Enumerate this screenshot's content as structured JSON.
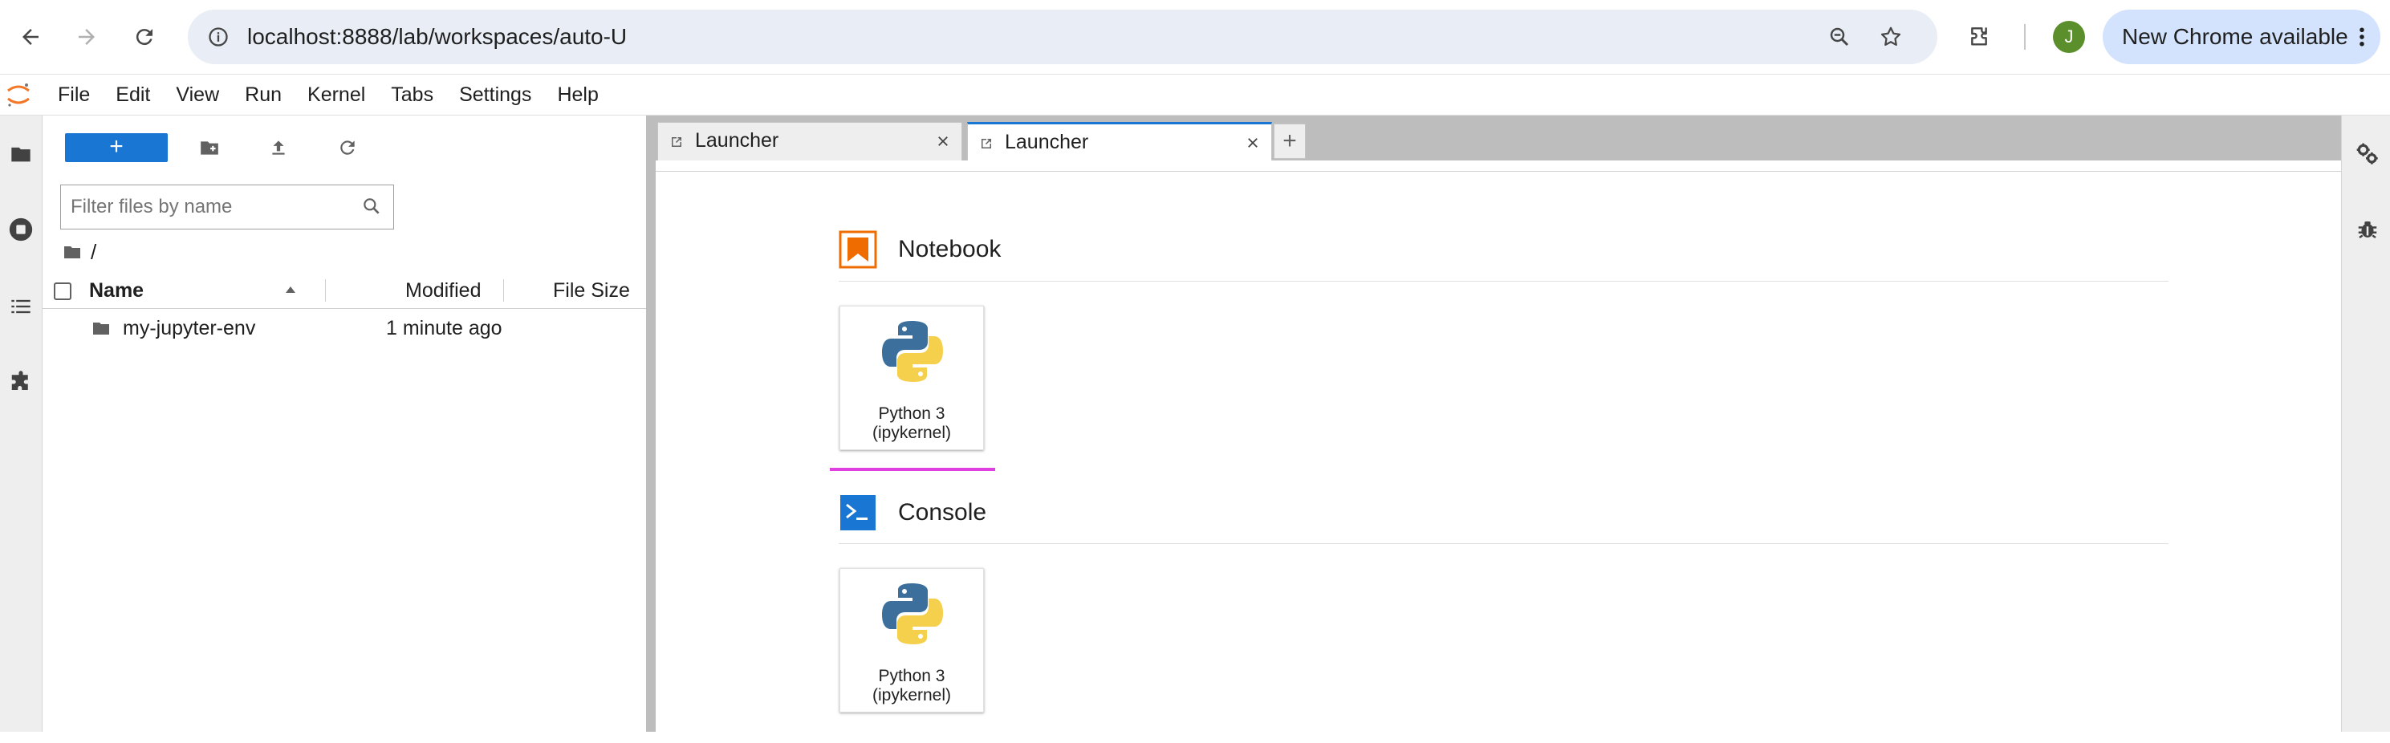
{
  "browser": {
    "url": "localhost:8888/lab/workspaces/auto-U",
    "avatar_letter": "J",
    "update_label": "New Chrome available",
    "icons": [
      "back-arrow-icon",
      "forward-arrow-icon",
      "reload-icon",
      "site-info-icon",
      "zoom-icon",
      "bookmark-star-icon",
      "extensions-icon",
      "more-vert-icon"
    ]
  },
  "menubar": {
    "items": [
      "File",
      "Edit",
      "View",
      "Run",
      "Kernel",
      "Tabs",
      "Settings",
      "Help"
    ]
  },
  "file_browser": {
    "new_button_label": "+",
    "filter_placeholder": "Filter files by name",
    "breadcrumb": "/",
    "columns": {
      "name": "Name",
      "modified": "Modified",
      "size": "File Size"
    },
    "rows": [
      {
        "name": "my-jupyter-env",
        "modified": "1 minute ago",
        "size": ""
      }
    ]
  },
  "tabs": [
    {
      "label": "Launcher",
      "active": false
    },
    {
      "label": "Launcher",
      "active": true
    }
  ],
  "add_tab_label": "+",
  "launcher": {
    "sections": [
      {
        "title": "Notebook",
        "cards": [
          {
            "label": "Python 3\n(ipykernel)"
          }
        ]
      },
      {
        "title": "Console",
        "cards": [
          {
            "label": "Python 3\n(ipykernel)"
          }
        ]
      }
    ]
  },
  "colors": {
    "accent": "#1976d2",
    "notebook_icon": "#ef6c00",
    "console_icon": "#1976d2",
    "focus_line": "#e040e0"
  }
}
